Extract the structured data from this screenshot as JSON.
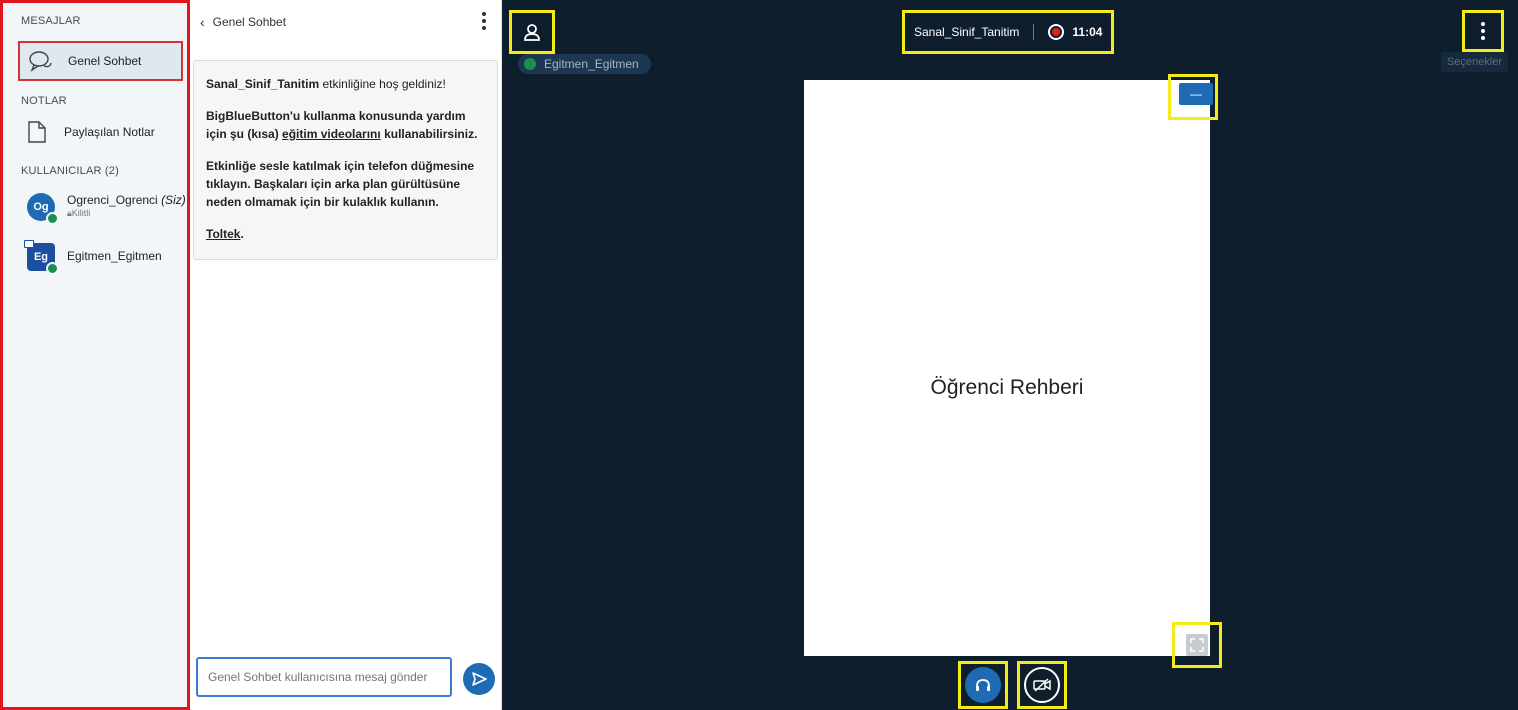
{
  "userlist": {
    "messages_title": "MESAJLAR",
    "chat_item_label": "Genel Sohbet",
    "notes_title": "NOTLAR",
    "notes_item_label": "Paylaşılan Notlar",
    "users_title": "KULLANICILAR (2)",
    "users": [
      {
        "initials": "Og",
        "name": "Ogrenci_Ogrenci",
        "suffix": "(Siz)",
        "status": "Kilitli"
      },
      {
        "initials": "Eg",
        "name": "Egitmen_Egitmen",
        "suffix": "",
        "status": ""
      }
    ]
  },
  "chat": {
    "header": "Genel Sohbet",
    "welcome_title": "Sanal_Sinif_Tanitim",
    "welcome_suffix": " etkinliğine hoş geldiniz!",
    "help_text_1": "BigBlueButton'u kullanma konusunda yardım için şu (kısa) ",
    "help_link": "eğitim videolarını",
    "help_text_2": " kullanabilirsiniz.",
    "audio_text": "Etkinliğe sesle katılmak için telefon düğmesine tıklayın. Başkaları için arka plan gürültüsüne neden olmamak için bir kulaklık kullanın.",
    "footer_link": "Toltek",
    "footer_dot": ".",
    "input_placeholder": "Genel Sohbet kullanıcısına mesaj gönder"
  },
  "main": {
    "meeting_title": "Sanal_Sinif_Tanitim",
    "recording_time": "11:04",
    "presenter_name": "Egitmen_Egitmen",
    "options_label": "Seçenekler",
    "slide_title": "Öğrenci Rehberi",
    "minimize_label": "—"
  },
  "colors": {
    "highlight": "#f4ec1a",
    "panel_border": "#e2141c",
    "accent": "#1f6ab4",
    "background": "#0f1e2d"
  },
  "icons": [
    "chat-bubbles-icon",
    "document-icon",
    "user-icon",
    "record-icon",
    "kebab-icon",
    "fullscreen-icon",
    "headphones-icon",
    "camera-off-icon",
    "send-icon",
    "chevron-left-icon"
  ]
}
